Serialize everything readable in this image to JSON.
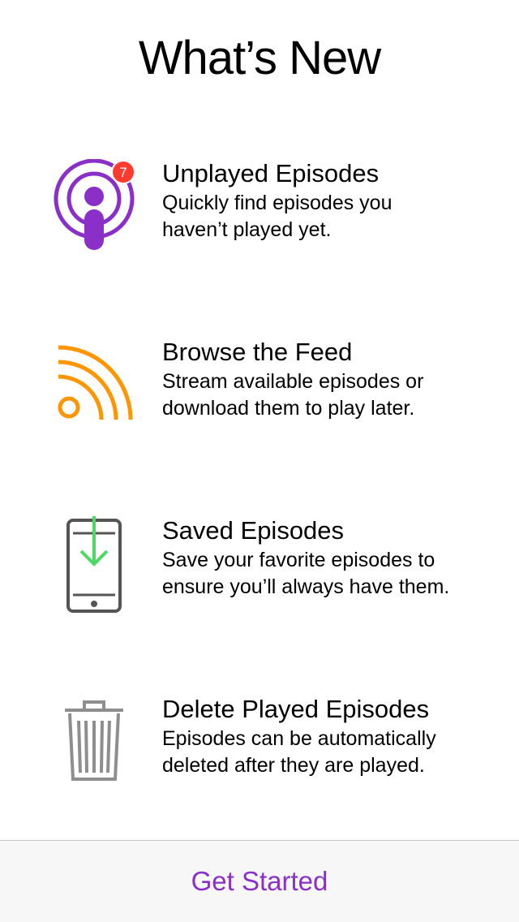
{
  "header": {
    "title": "What’s New"
  },
  "features": [
    {
      "icon": "podcast-unplayed-icon",
      "badge": "7",
      "title": "Unplayed Episodes",
      "line1": "Quickly find episodes you",
      "line2": "haven’t played yet."
    },
    {
      "icon": "rss-feed-icon",
      "title": "Browse the Feed",
      "line1": "Stream available episodes or",
      "line2": "download them to play later."
    },
    {
      "icon": "phone-download-icon",
      "title": "Saved Episodes",
      "line1": "Save your favorite episodes to",
      "line2": "ensure you’ll always have them."
    },
    {
      "icon": "trash-icon",
      "title": "Delete Played Episodes",
      "line1": "Episodes can be automatically",
      "line2": "deleted after they are played."
    }
  ],
  "footer": {
    "button_label": "Get Started"
  },
  "colors": {
    "podcast_purple": "#8a2fc7",
    "badge_red": "#ff3b30",
    "feed_orange": "#ff9500",
    "download_green": "#4cd964",
    "icon_gray": "#555555",
    "trash_gray": "#8e8e8e",
    "accent": "#8a2fc7"
  }
}
